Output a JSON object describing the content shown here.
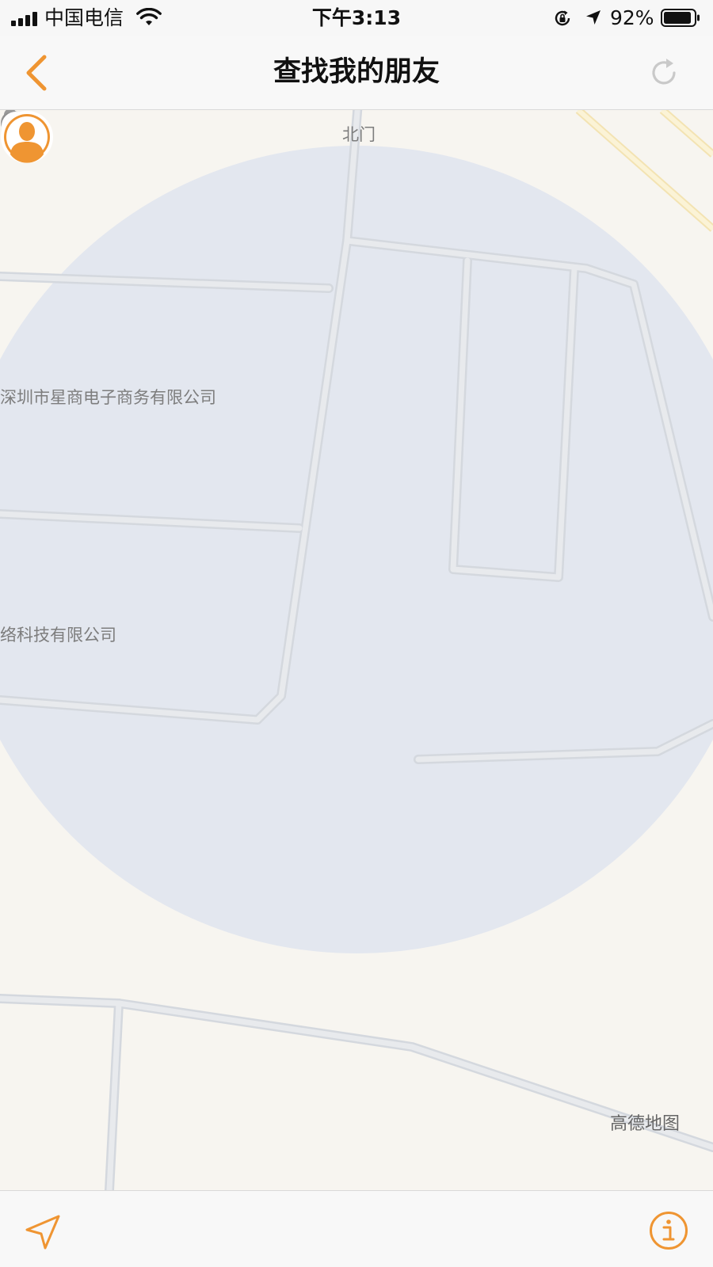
{
  "status_bar": {
    "carrier": "中国电信",
    "time": "下午3:13",
    "battery_percent": "92%",
    "battery_level": 0.92,
    "icons": [
      "signal-icon",
      "wifi-icon",
      "orientation-lock-icon",
      "location-arrow-icon",
      "battery-icon"
    ]
  },
  "nav": {
    "title": "查找我的朋友",
    "back_icon": "chevron-left-icon",
    "refresh_icon": "refresh-icon"
  },
  "map": {
    "labels": {
      "north_gate": "北门",
      "company_1": "深圳市星商电子商务有限公司",
      "company_2": "络科技有限公司"
    },
    "brand": "高德地图",
    "icons": [
      "parking-icon",
      "friend-avatar-icon",
      "my-location-icon"
    ]
  },
  "toolbar": {
    "locate_icon": "location-arrow-outline-icon",
    "info_icon": "info-icon"
  },
  "colors": {
    "accent": "#ef9532",
    "location_blue": "#3d82ea",
    "accuracy_circle": "#e3e7ef",
    "road": "#dcdfe3",
    "map_background": "#f7f5f0"
  }
}
